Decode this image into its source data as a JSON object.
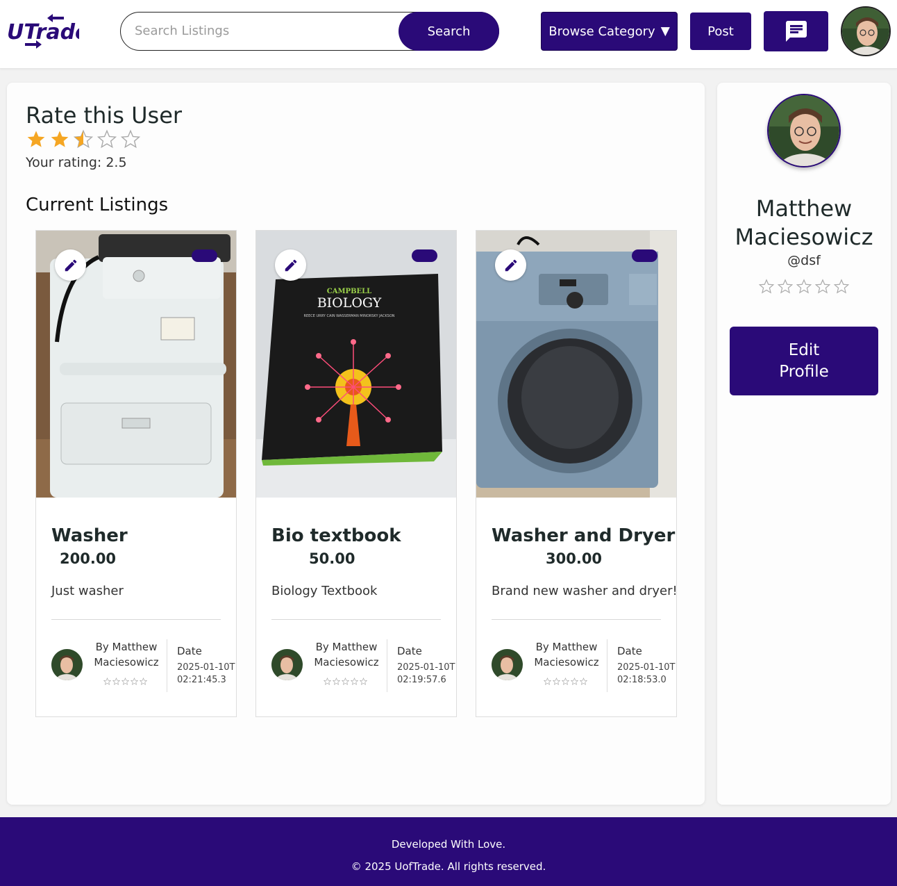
{
  "brand": {
    "logo_text": "UTrade",
    "accent": "#2a0a78",
    "star_color": "#f5a623"
  },
  "header": {
    "search_placeholder": "Search Listings",
    "search_label": "Search",
    "browse_label": "Browse Category",
    "browse_caret": "▼",
    "post_label": "Post",
    "chat_icon": "chat-icon"
  },
  "rating": {
    "title": "Rate this User",
    "value": 2.5,
    "max": 5,
    "text": "Your rating: 2.5"
  },
  "listings": {
    "title": "Current Listings",
    "items": [
      {
        "title": "Washer",
        "price": "200.00",
        "description": "Just washer",
        "seller": "By Matthew Maciesowicz",
        "date_label": "Date",
        "date": "2025-01-10T02:21:45.3",
        "seller_rating": 0
      },
      {
        "title": "Bio textbook",
        "price": "50.00",
        "description": "Biology Textbook",
        "seller": "By Matthew Maciesowicz",
        "date_label": "Date",
        "date": "2025-01-10T02:19:57.6",
        "seller_rating": 0
      },
      {
        "title": "Washer and Dryer",
        "price": "300.00",
        "description": "Brand new washer and dryer!",
        "seller": "By Matthew Maciesowicz",
        "date_label": "Date",
        "date": "2025-01-10T02:18:53.0",
        "seller_rating": 0
      }
    ]
  },
  "profile": {
    "name": "Matthew Maciesowicz",
    "handle": "@dsf",
    "rating": 0,
    "edit_label": "Edit Profile"
  },
  "footer": {
    "line1": "Developed With Love.",
    "line2": "© 2025 UofTrade. All rights reserved."
  }
}
